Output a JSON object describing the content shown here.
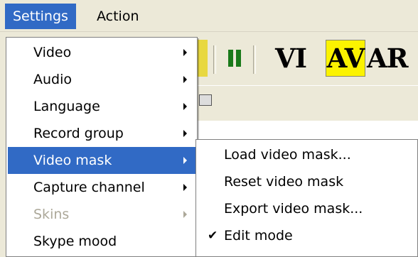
{
  "menubar": {
    "items": [
      {
        "label": "Settings"
      },
      {
        "label": "Action"
      }
    ]
  },
  "toolbar": {
    "buttons": [
      {
        "label": "",
        "icon": "pause-icon"
      },
      {
        "label": "VI"
      },
      {
        "label": "AV"
      },
      {
        "label": "AR"
      }
    ],
    "pressed_color": "#fbf300"
  },
  "settings_menu": {
    "items": [
      {
        "label": "Video",
        "has_submenu": true
      },
      {
        "label": "Audio",
        "has_submenu": true
      },
      {
        "label": "Language",
        "has_submenu": true
      },
      {
        "label": "Record group",
        "has_submenu": true
      },
      {
        "label": "Video mask",
        "has_submenu": true,
        "selected": true
      },
      {
        "label": "Capture channel",
        "has_submenu": true
      },
      {
        "label": "Skins",
        "has_submenu": true,
        "disabled": true
      },
      {
        "label": "Skype mood",
        "has_submenu": false
      }
    ]
  },
  "video_mask_submenu": {
    "items": [
      {
        "label": "Load video mask..."
      },
      {
        "label": "Reset video mask"
      },
      {
        "label": "Export video mask..."
      },
      {
        "label": "Edit mode",
        "checked": true,
        "check_glyph": "✔"
      }
    ]
  },
  "colors": {
    "highlight": "#316ac5",
    "menubar_bg": "#ece9d8",
    "pause_green": "#1a7a1a"
  }
}
